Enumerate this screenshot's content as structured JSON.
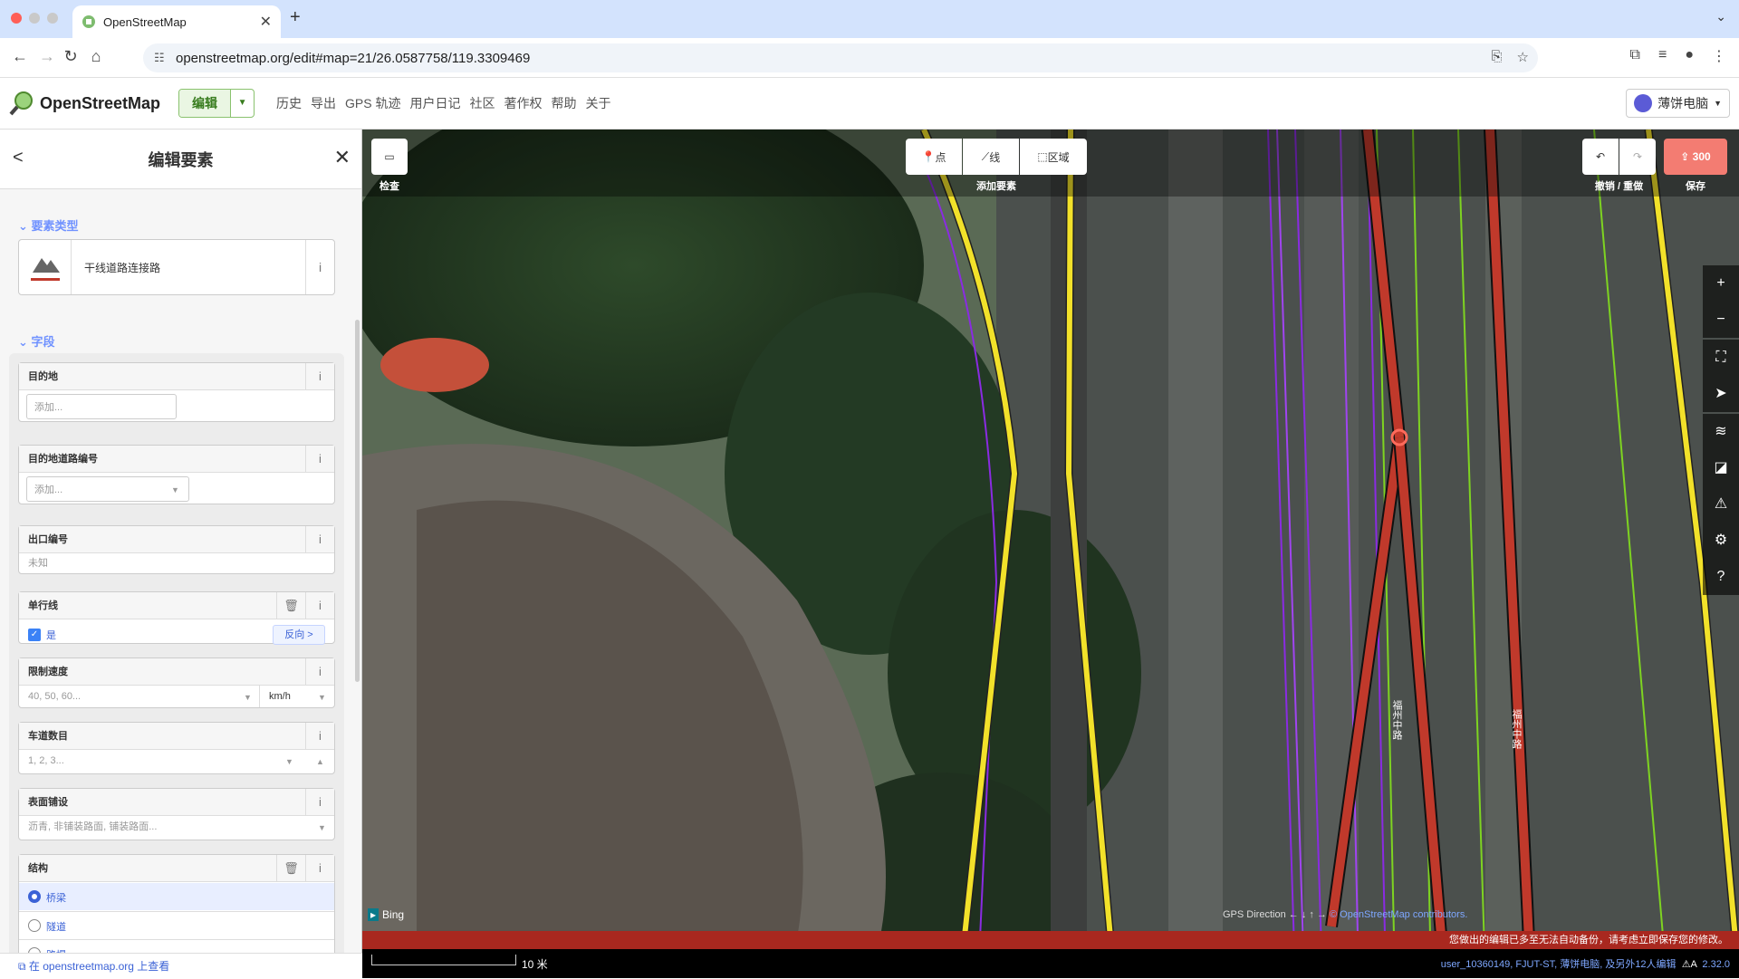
{
  "browser": {
    "tab_title": "OpenStreetMap",
    "url": "openstreetmap.org/edit#map=21/26.0587758/119.3309469"
  },
  "osm_header": {
    "logo": "OpenStreetMap",
    "edit_label": "编辑",
    "nav": [
      "历史",
      "导出",
      "GPS 轨迹",
      "用户日记",
      "社区",
      "著作权",
      "帮助",
      "关于"
    ],
    "user": "薄饼电脑"
  },
  "sidebar": {
    "title": "编辑要素",
    "section_type": "要素类型",
    "preset_name": "干线道路连接路",
    "section_fields": "字段",
    "fields": {
      "destination": {
        "label": "目的地",
        "placeholder": "添加..."
      },
      "destination_ref": {
        "label": "目的地道路编号",
        "placeholder": "添加..."
      },
      "exit_ref": {
        "label": "出口编号",
        "placeholder": "未知"
      },
      "oneway": {
        "label": "单行线",
        "value": "是",
        "reverse": "反向 >"
      },
      "maxspeed": {
        "label": "限制速度",
        "placeholder": "40, 50, 60...",
        "unit": "km/h"
      },
      "lanes": {
        "label": "车道数目",
        "placeholder": "1, 2, 3..."
      },
      "surface": {
        "label": "表面铺设",
        "placeholder": "沥青, 非铺装路面, 铺装路面..."
      },
      "structure": {
        "label": "结构",
        "options": [
          "桥梁",
          "隧道",
          "路堤"
        ],
        "selected": "桥梁"
      }
    },
    "footer_link": "在 openstreetmap.org 上查看"
  },
  "map": {
    "inspect_label": "检查",
    "add_point": "点",
    "add_line": "线",
    "add_area": "区域",
    "add_feature_label": "添加要素",
    "undo_redo_label": "撤销 / 重做",
    "save_count": "300",
    "save_label": "保存",
    "bing": "Bing",
    "gps_direction": "GPS Direction",
    "attribution": "© OpenStreetMap contributors.",
    "warning": "您做出的编辑已多至无法自动备份，请考虑立即保存您的修改。",
    "scale": "10 米",
    "users": "user_10360149, FJUT-ST, 薄饼电脑, 及另外12人编辑",
    "version": "2.32.0",
    "road_label": "福州中路"
  },
  "colors": {
    "road_yellow": "#f2e12a",
    "road_red": "#c0392b",
    "gps_purple": "#8a2be2",
    "gps_green": "#7ed321",
    "accent": "#7092ff",
    "save": "#f37c72"
  }
}
